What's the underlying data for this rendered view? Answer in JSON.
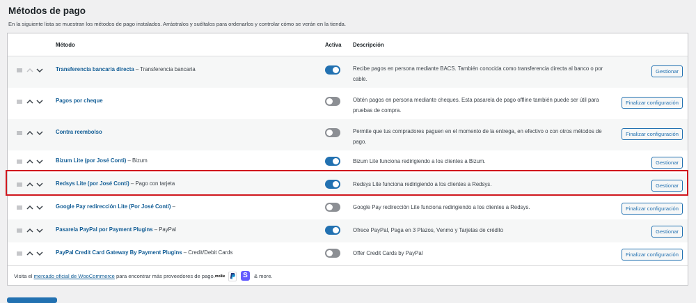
{
  "header": {
    "title": "Métodos de pago",
    "description": "En la siguiente lista se muestran los métodos de pago instalados. Arrástralos y suéltalos para ordenarlos y controlar cómo se verán en la tienda."
  },
  "columns": {
    "method": "Método",
    "active": "Activa",
    "description": "Descripción"
  },
  "rows": [
    {
      "name": "Transferencia bancaria directa",
      "suffix": " – Transferencia bancaria",
      "active": true,
      "description": "Recibe pagos en persona mediante BACS. También conocida como transferencia directa al banco o por cable.",
      "action": "Gestionar"
    },
    {
      "name": "Pagos por cheque",
      "suffix": "",
      "active": false,
      "description": "Obtén pagos en persona mediante cheques. Esta pasarela de pago offline también puede ser útil para pruebas de compra.",
      "action": "Finalizar configuración"
    },
    {
      "name": "Contra reembolso",
      "suffix": "",
      "active": false,
      "description": "Permite que tus compradores paguen en el momento de la entrega, en efectivo o con otros métodos de pago.",
      "action": "Finalizar configuración"
    },
    {
      "name": "Bizum Lite (por José Conti)",
      "suffix": " – Bizum",
      "active": true,
      "description": "Bizum Lite funciona redirigiendo a los clientes a Bizum.",
      "action": "Gestionar"
    },
    {
      "name": "Redsys Lite (por José Conti)",
      "suffix": " – Pago con tarjeta",
      "active": true,
      "description": "Redsys Lite funciona redirigiendo a los clientes a Redsys.",
      "action": "Gestionar"
    },
    {
      "name": "Google Pay redirección Lite (Por José Conti)",
      "suffix": " –",
      "active": false,
      "description": "Google Pay redirección Lite funciona redirigiendo a los clientes a Redsys.",
      "action": "Finalizar configuración"
    },
    {
      "name": "Pasarela PayPal por Payment Plugins",
      "suffix": " – PayPal",
      "active": true,
      "description": "Ofrece PayPal, Paga en 3 Plazos, Venmo y Tarjetas de crédito",
      "action": "Gestionar"
    },
    {
      "name": "PayPal Credit Card Gateway By Payment Plugins",
      "suffix": " – Credit/Debit Cards",
      "active": false,
      "description": "Offer Credit Cards by PayPal",
      "action": "Finalizar configuración"
    }
  ],
  "footer": {
    "before": "Visita el ",
    "link": "mercado oficial de WooCommerce",
    "after": " para encontrar más proveedores de pago.",
    "logo_mollie": "mollie",
    "logo_stripe": "S",
    "more": "& more."
  },
  "colors": {
    "accent": "#2271b1",
    "link": "#135e96",
    "highlight": "#d1171e",
    "toggle_off": "#8c8f94"
  }
}
